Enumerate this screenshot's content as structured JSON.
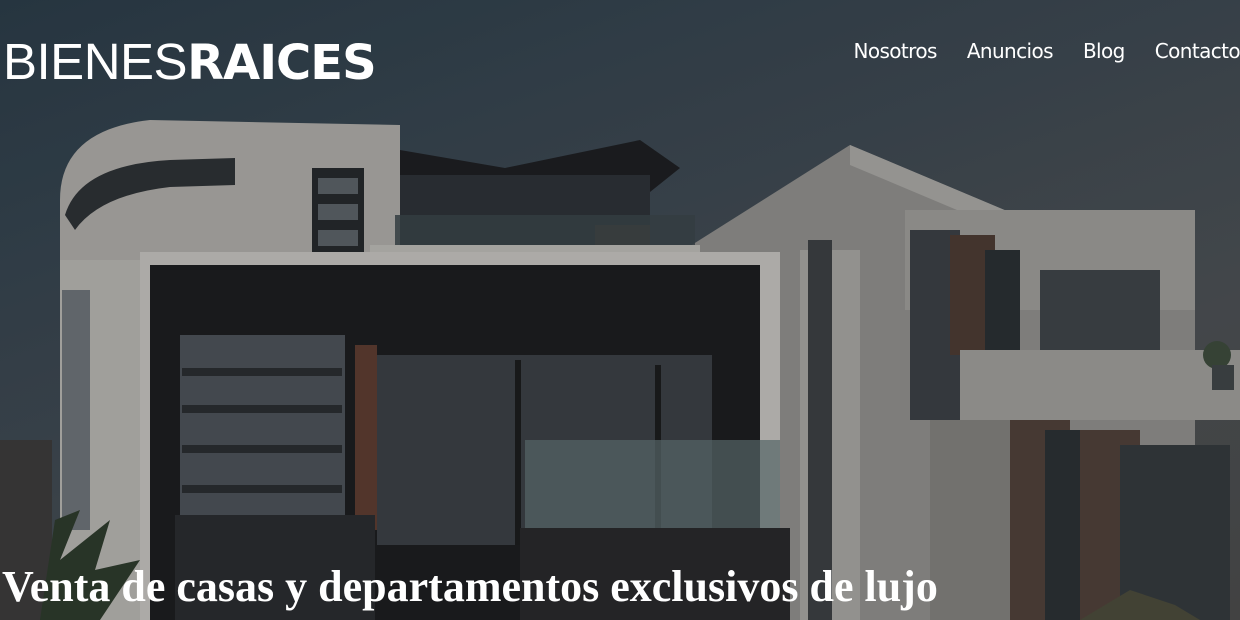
{
  "header": {
    "logo": {
      "light": "BIENES",
      "bold": "RAICES"
    },
    "nav": [
      {
        "label": "Nosotros"
      },
      {
        "label": "Anuncios"
      },
      {
        "label": "Blog"
      },
      {
        "label": "Contacto"
      }
    ]
  },
  "hero": {
    "title": "Venta de casas y departamentos exclusivos de lujo",
    "image_description_icon": "modern-house-photo"
  },
  "colors": {
    "text": "#ffffff",
    "sky": "#2b3c48",
    "wall": "#c9c7c2",
    "dark": "#1b1c1e"
  }
}
